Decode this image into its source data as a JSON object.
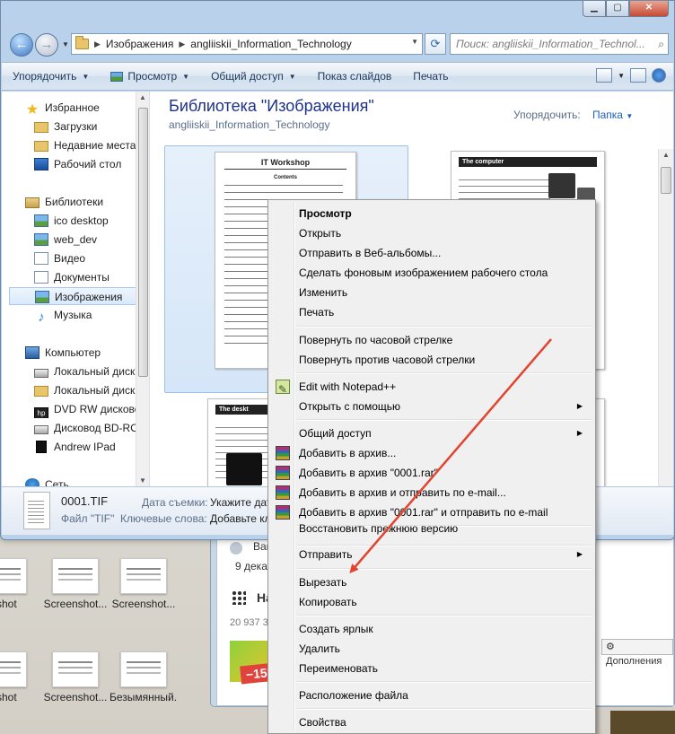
{
  "explorer": {
    "breadcrumb": [
      "Изображения",
      "angliiskii_Information_Technology"
    ],
    "search_placeholder": "Поиск: angliiskii_Information_Technol...",
    "caption": {
      "minimize": "▁",
      "maximize": "▢",
      "close": "✕"
    },
    "toolbar": {
      "organize": "Упорядочить",
      "preview": "Просмотр",
      "share": "Общий доступ",
      "slideshow": "Показ слайдов",
      "print": "Печать"
    },
    "nav": {
      "favorites": "Избранное",
      "downloads": "Загрузки",
      "recent": "Недавние места",
      "desktop": "Рабочий стол",
      "libraries": "Библиотеки",
      "ico_desktop": "ico desktop",
      "web_dev": "web_dev",
      "video": "Видео",
      "documents": "Документы",
      "pictures": "Изображения",
      "music": "Музыка",
      "computer": "Компьютер",
      "local_disk_1": "Локальный диск",
      "local_disk_2": "Локальный диск",
      "dvd": "DVD RW дисковод",
      "bd": "Дисковод BD-RO",
      "ipad": "Andrew IPad",
      "network": "Сеть"
    },
    "library": {
      "title": "Библиотека \"Изображения\"",
      "subtitle": "angliiskii_Information_Technology",
      "arrange_label": "Упорядочить:",
      "arrange_value": "Папка"
    },
    "thumbs": {
      "t1_heading": "IT Workshop",
      "t1_contents": "Contents",
      "t2_heading": "The computer",
      "t3_heading": "The deskt"
    },
    "details": {
      "filename": "0001.TIF",
      "filetype": "Файл \"TIF\"",
      "date_key": "Дата съемки:",
      "date_val": "Укажите дат",
      "tags_key": "Ключевые слова:",
      "tags_val": "Добавьте кл"
    }
  },
  "context_menu": {
    "items": [
      {
        "label": "Просмотр",
        "bold": true
      },
      {
        "label": "Открыть"
      },
      {
        "label": "Отправить в Веб-альбомы..."
      },
      {
        "label": "Сделать фоновым изображением рабочего стола"
      },
      {
        "label": "Изменить"
      },
      {
        "label": "Печать"
      },
      {
        "label": "Повернуть по часовой стрелке"
      },
      {
        "label": "Повернуть против часовой стрелки"
      },
      {
        "label": "Edit with Notepad++"
      },
      {
        "label": "Открыть с помощью"
      },
      {
        "label": "Общий доступ"
      },
      {
        "label": "Добавить в архив..."
      },
      {
        "label": "Добавить в архив \"0001.rar\""
      },
      {
        "label": "Добавить в архив и отправить по e-mail..."
      },
      {
        "label": "Добавить в архив \"0001.rar\" и отправить по e-mail"
      },
      {
        "label": "Восстановить прежнюю версию"
      },
      {
        "label": "Отправить"
      },
      {
        "label": "Вырезать"
      },
      {
        "label": "Копировать"
      },
      {
        "label": "Создать ярлык"
      },
      {
        "label": "Удалить"
      },
      {
        "label": "Переименовать"
      },
      {
        "label": "Расположение файла"
      },
      {
        "label": "Свойства"
      }
    ]
  },
  "desktop": {
    "icons": [
      "nshot",
      "Screenshot...",
      "Screenshot...",
      "nshot",
      "Screenshot...",
      "Безымянный..."
    ]
  },
  "background_window": {
    "line1": "Ваш",
    "line2": "9 декаб",
    "line3": "На",
    "line4": "20 937 36",
    "discount": "−15%",
    "addons": "Дополнения"
  },
  "colors": {
    "annotation_arrow": "#e2452f",
    "title_text": "#1e3287"
  }
}
